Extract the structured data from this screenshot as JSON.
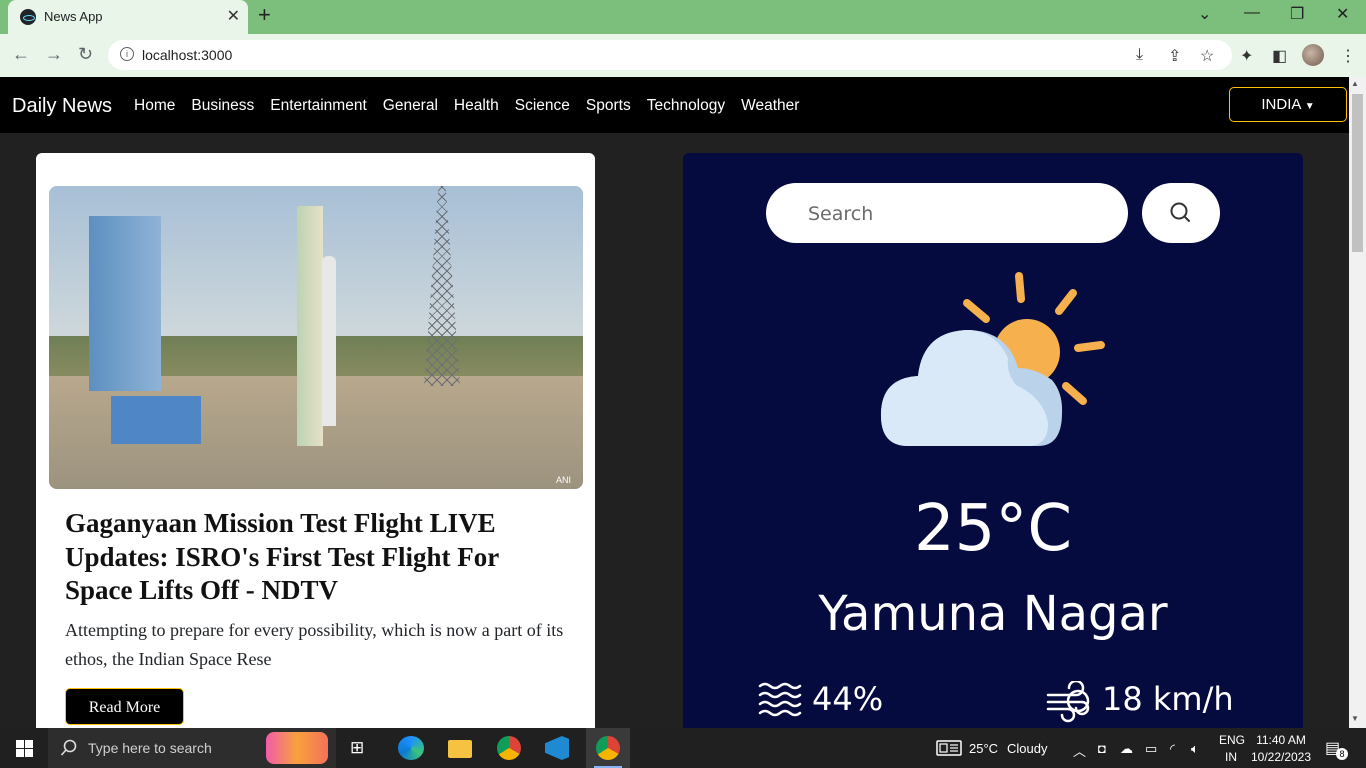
{
  "browser": {
    "tab_title": "News App",
    "url": "localhost:3000"
  },
  "navbar": {
    "brand": "Daily News",
    "links": [
      "Home",
      "Business",
      "Entertainment",
      "General",
      "Health",
      "Science",
      "Sports",
      "Technology",
      "Weather"
    ],
    "country_button": "INDIA"
  },
  "news_card": {
    "image_credit": "ANI",
    "headline": "Gaganyaan Mission Test Flight LIVE Updates: ISRO's First Test Flight For Space Lifts Off - NDTV",
    "description": "Attempting to prepare for every possibility, which is now a part of its ethos, the Indian Space Rese",
    "read_more_label": "Read More"
  },
  "weather": {
    "search_placeholder": "Search",
    "temperature": "25°C",
    "city": "Yamuna Nagar",
    "humidity": "44%",
    "wind_speed": "18 km/h",
    "condition_icon": "partly-cloudy-icon",
    "colors": {
      "background": "#050a3f",
      "sun": "#f6b04e",
      "cloud": "#d9e9f7"
    }
  },
  "taskbar": {
    "search_placeholder": "Type here to search",
    "weather_temp": "25°C",
    "weather_text": "Cloudy",
    "lang_top": "ENG",
    "lang_bottom": "IN",
    "time": "11:40 AM",
    "date": "10/22/2023",
    "notification_count": "8"
  }
}
